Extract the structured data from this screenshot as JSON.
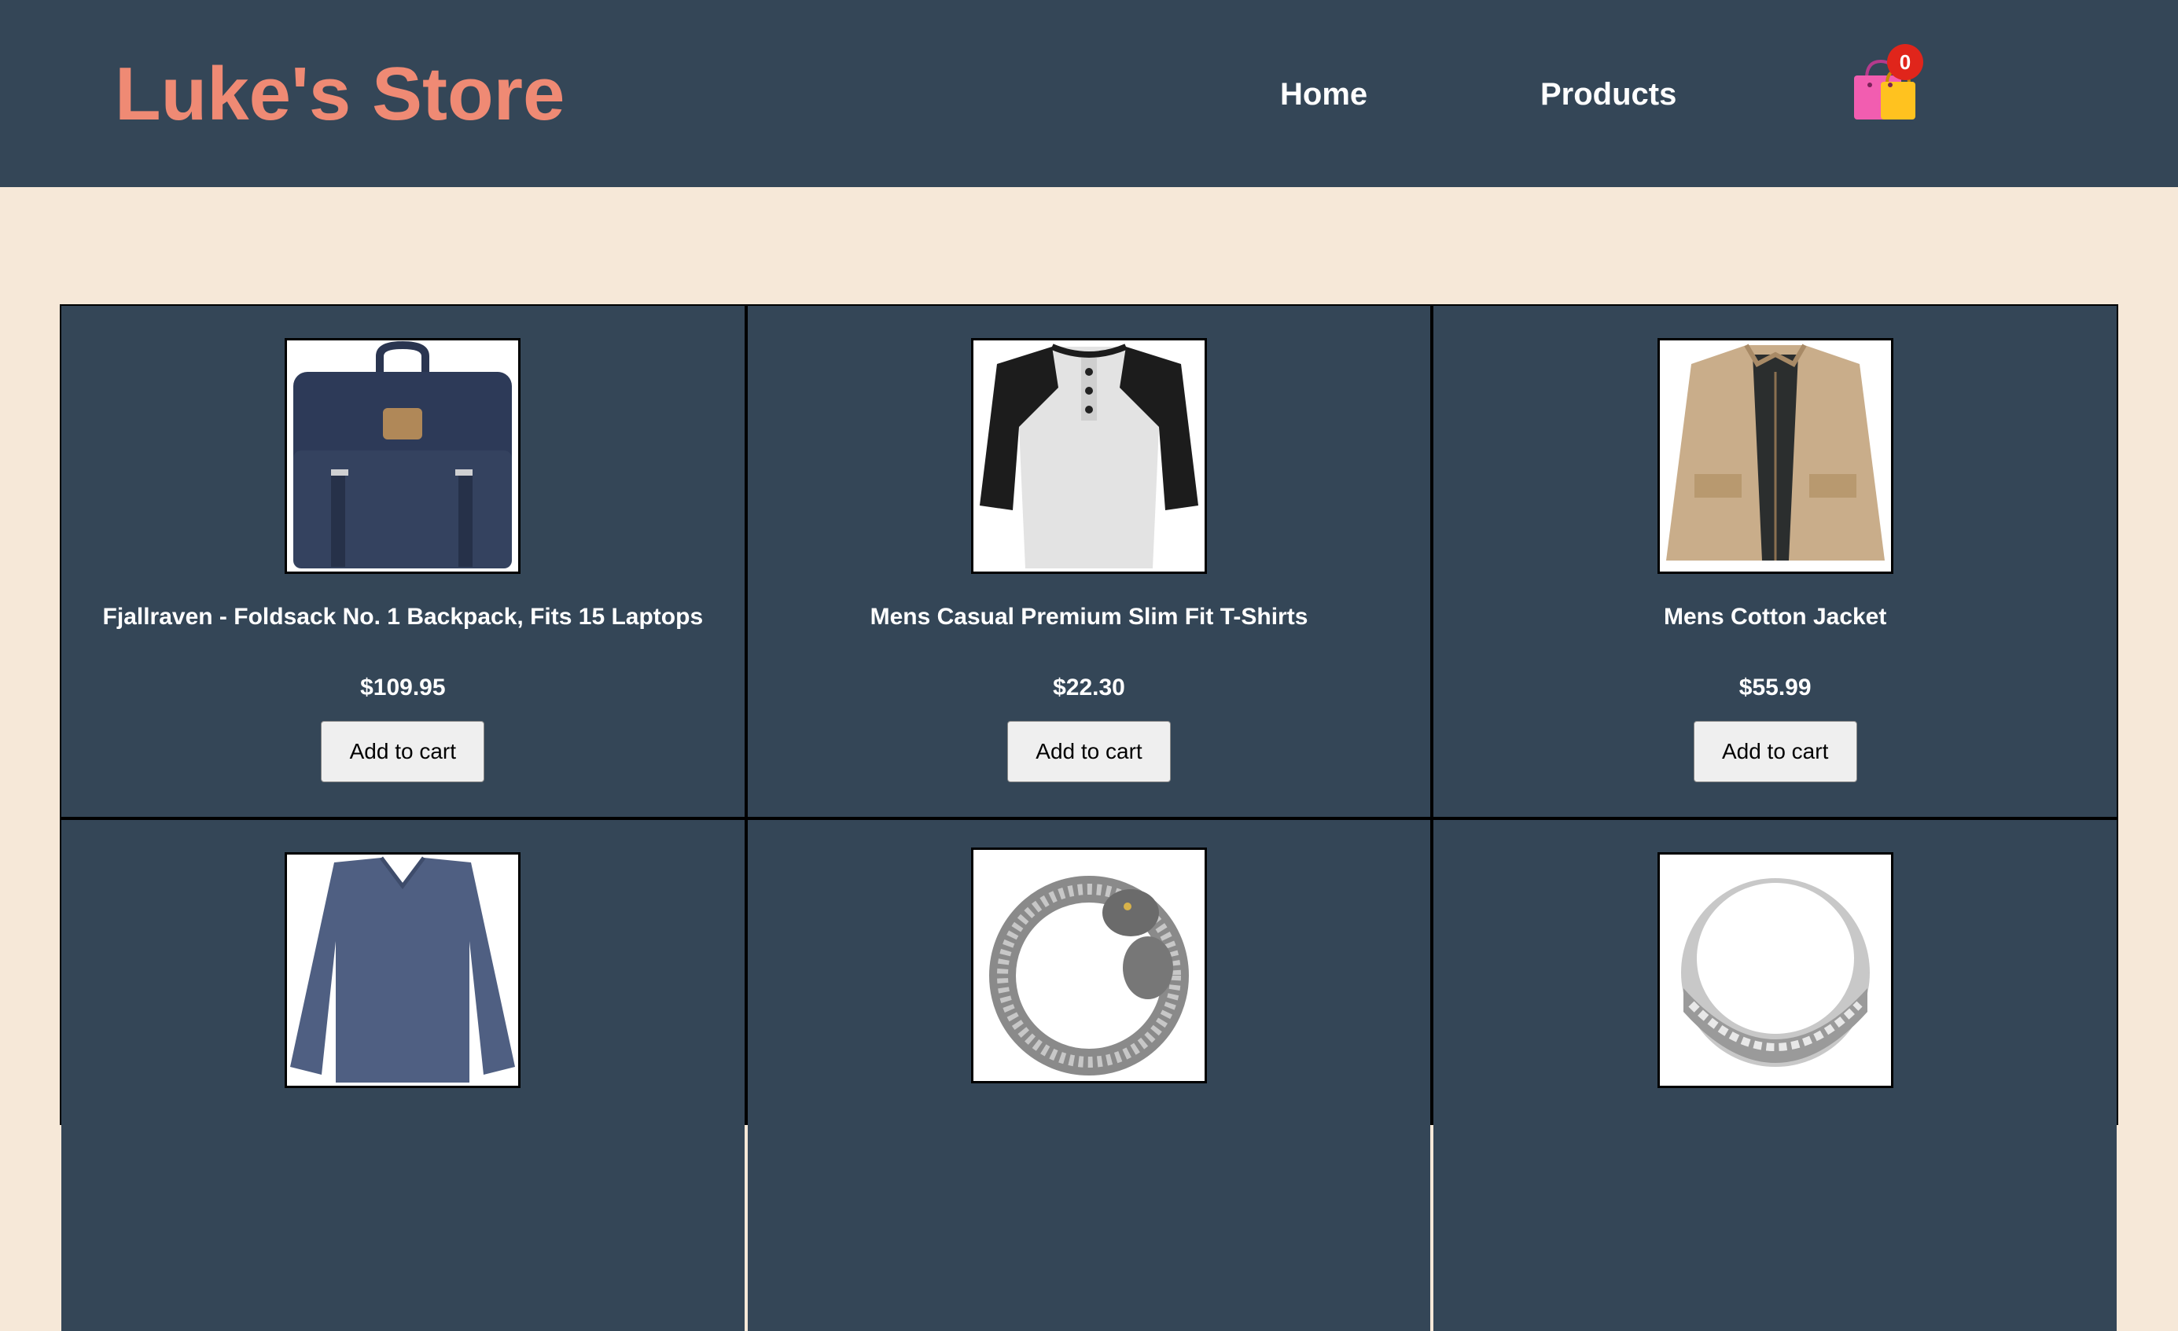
{
  "header": {
    "logo": "Luke's Store",
    "nav": {
      "home": "Home",
      "products": "Products"
    },
    "cart": {
      "icon": "shopping-bags-icon",
      "count": "0"
    }
  },
  "products": [
    {
      "title": "Fjallraven - Foldsack No. 1 Backpack, Fits 15 Laptops",
      "price": "$109.95",
      "button": "Add to cart",
      "image": "backpack-image"
    },
    {
      "title": "Mens Casual Premium Slim Fit T-Shirts",
      "price": "$22.30",
      "button": "Add to cart",
      "image": "tshirt-image"
    },
    {
      "title": "Mens Cotton Jacket",
      "price": "$55.99",
      "button": "Add to cart",
      "image": "jacket-image"
    },
    {
      "image": "long-sleeve-shirt-image"
    },
    {
      "image": "dragon-bracelet-image"
    },
    {
      "image": "silver-ring-image"
    }
  ],
  "colors": {
    "header_bg": "#344657",
    "page_bg": "#f6e8d8",
    "logo": "#ef8a74",
    "badge": "#e0251b"
  }
}
